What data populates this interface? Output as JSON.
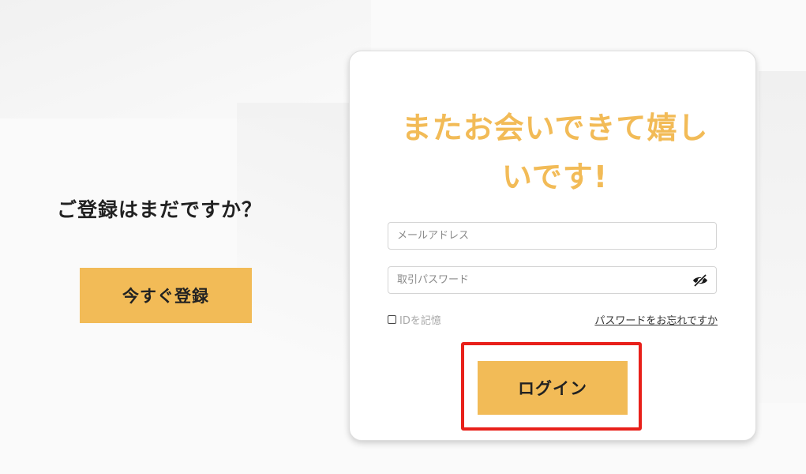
{
  "register": {
    "prompt": "ご登録はまだですか？",
    "button_label": "今すぐ登録"
  },
  "login": {
    "heading": "またお会いできて嬉しいです!",
    "email_placeholder": "メールアドレス",
    "password_placeholder": "取引パスワード",
    "password_visibility_icon": "eye-slash-icon",
    "remember_label": "IDを記憶",
    "remember_checked": false,
    "forgot_link": "パスワードをお忘れですか",
    "button_label": "ログイン"
  },
  "colors": {
    "accent": "#f2bb57",
    "highlight": "#e8201a",
    "text_dark": "#222222",
    "text_muted": "#a8a8a8"
  }
}
